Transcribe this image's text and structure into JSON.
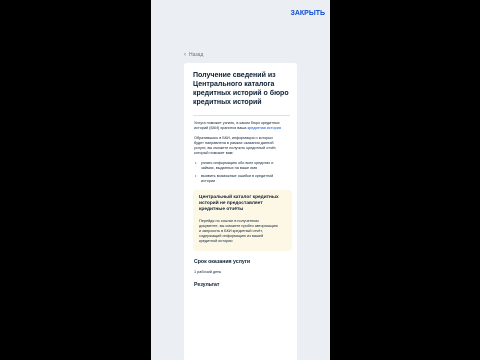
{
  "header": {
    "close_label": "ЗАКРЫТЬ"
  },
  "nav": {
    "back_label": "Назад"
  },
  "service": {
    "title": "Получение сведений из Центрального каталога кредитных историй о бюро кредитных историй",
    "intro_text": "Услуга поможет узнать, в каком бюро кредитных историй (БКИ) хранится ваша",
    "intro_link": "кредитная история",
    "details": "Обратившись в БКИ, информация о которых будет направлена в рамках оказания данной услуги, вы сможете получить кредитный отчёт, который поможет вам:",
    "bullets": [
      "узнать информацию обо всех кредитах и займах, выданных на ваше имя",
      "выявить возможные ошибки в кредитной истории"
    ],
    "notice": {
      "title": "Центральный каталог кредитных историй не предоставляет кредитные отчёты",
      "text": "Перейдя по ссылке в полученном документе, вы сможете пройти авторизацию и запросить в БКИ кредитный отчёт, содержащий информацию из вашей кредитной истории"
    },
    "term_heading": "Срок оказания услуги",
    "term_value": "1 рабочий день",
    "result_heading": "Результат"
  }
}
